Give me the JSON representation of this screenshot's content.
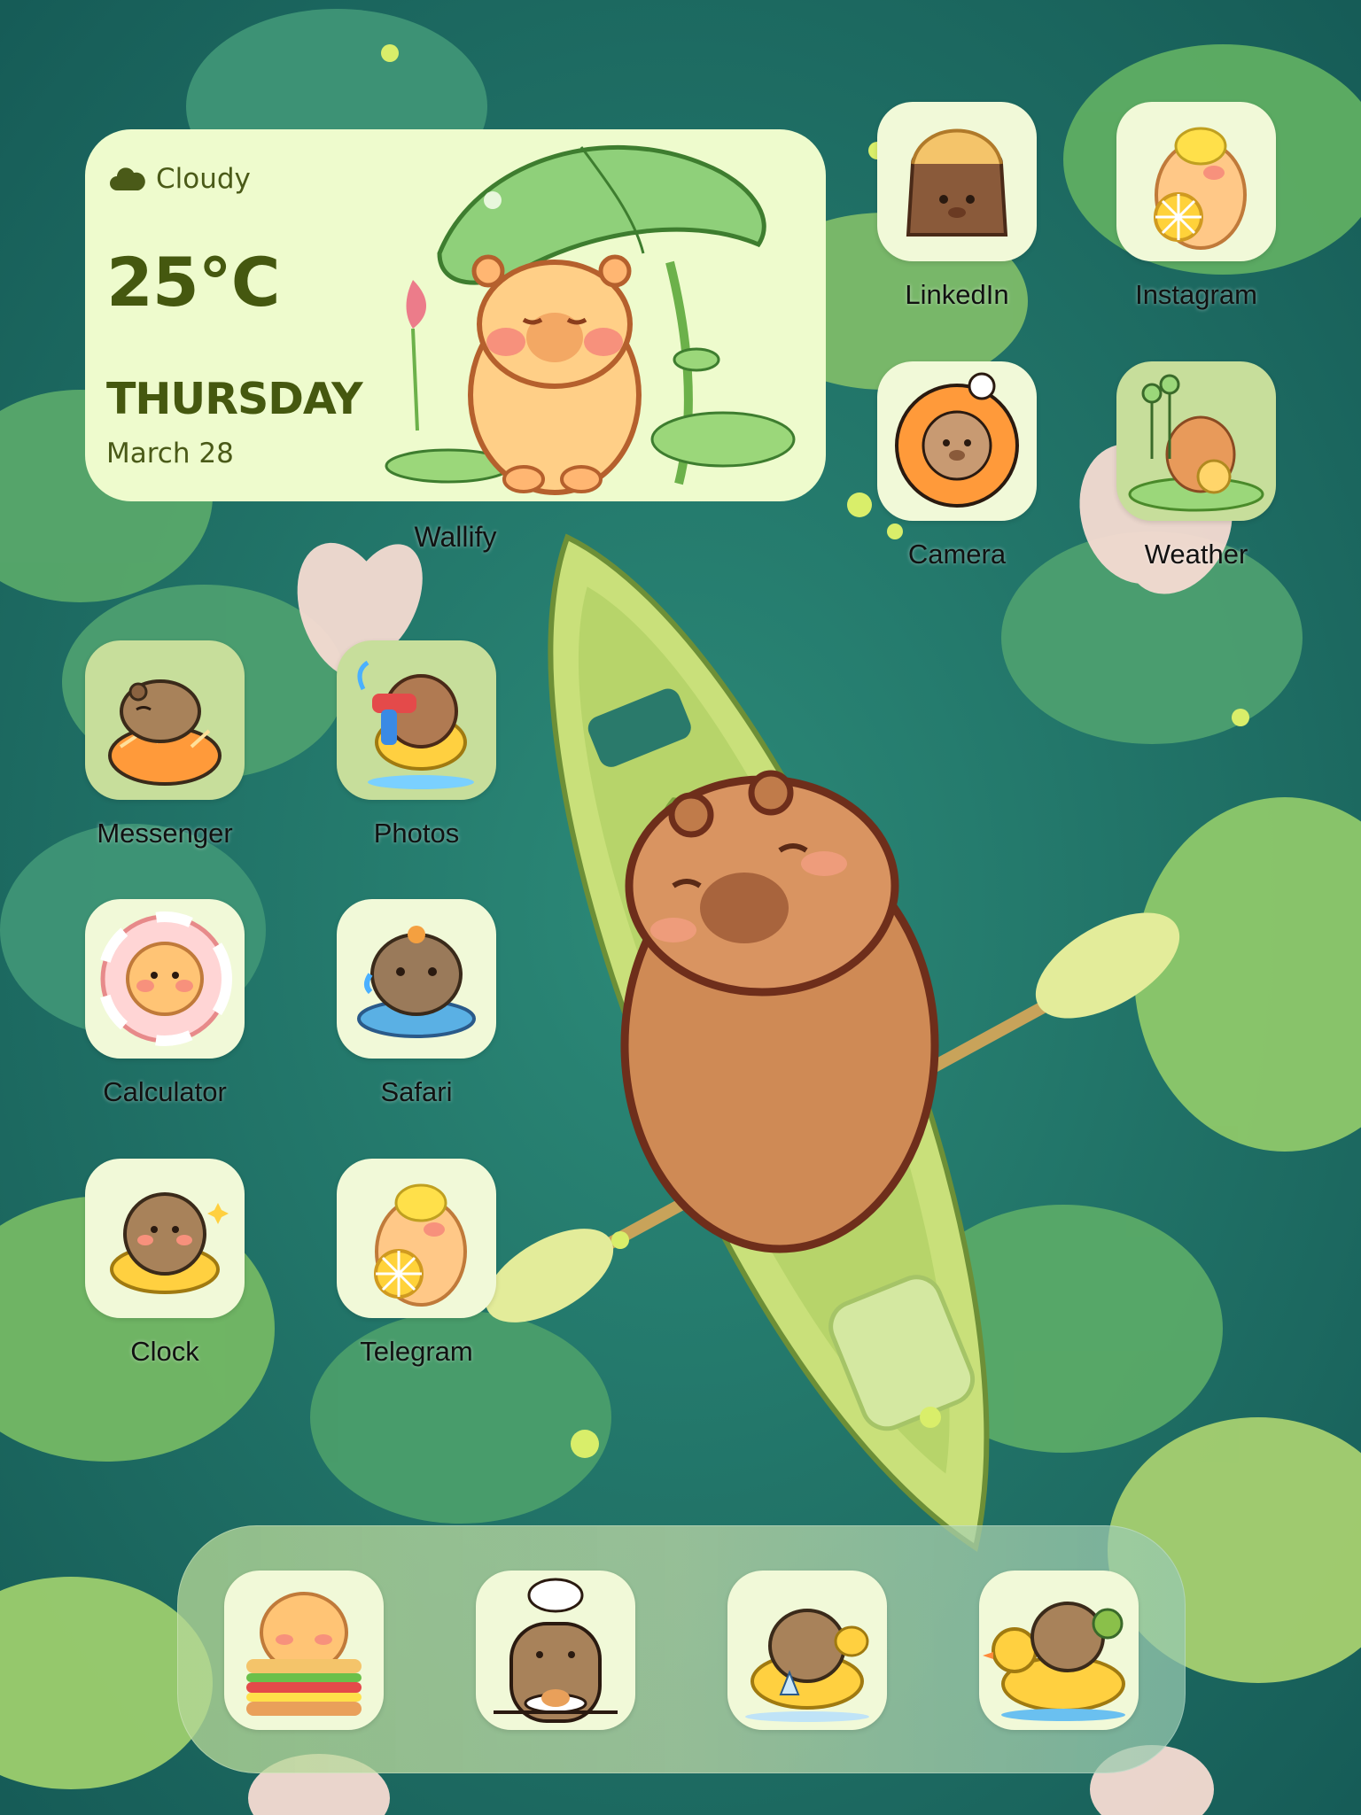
{
  "widget": {
    "condition": "Cloudy",
    "temperature": "25°C",
    "day": "THURSDAY",
    "date": "March 28",
    "label": "Wallify",
    "condition_icon": "cloud-icon"
  },
  "apps": [
    {
      "label": "LinkedIn"
    },
    {
      "label": "Instagram"
    },
    {
      "label": "Camera"
    },
    {
      "label": "Weather"
    },
    {
      "label": "Messenger"
    },
    {
      "label": "Photos"
    },
    {
      "label": "Calculator"
    },
    {
      "label": "Safari"
    },
    {
      "label": "Clock"
    },
    {
      "label": "Telegram"
    }
  ],
  "dock": {
    "apps": [
      {
        "icon": "capybara-sandwich-icon"
      },
      {
        "icon": "capybara-chef-icon"
      },
      {
        "icon": "capybara-swim-ring-icon"
      },
      {
        "icon": "capybara-duck-float-icon"
      }
    ]
  },
  "colors": {
    "widget_background": "#eefbcd",
    "widget_text": "#45580f",
    "icon_background": "#f1f9d8",
    "wallpaper_water": "#1f6f66"
  }
}
